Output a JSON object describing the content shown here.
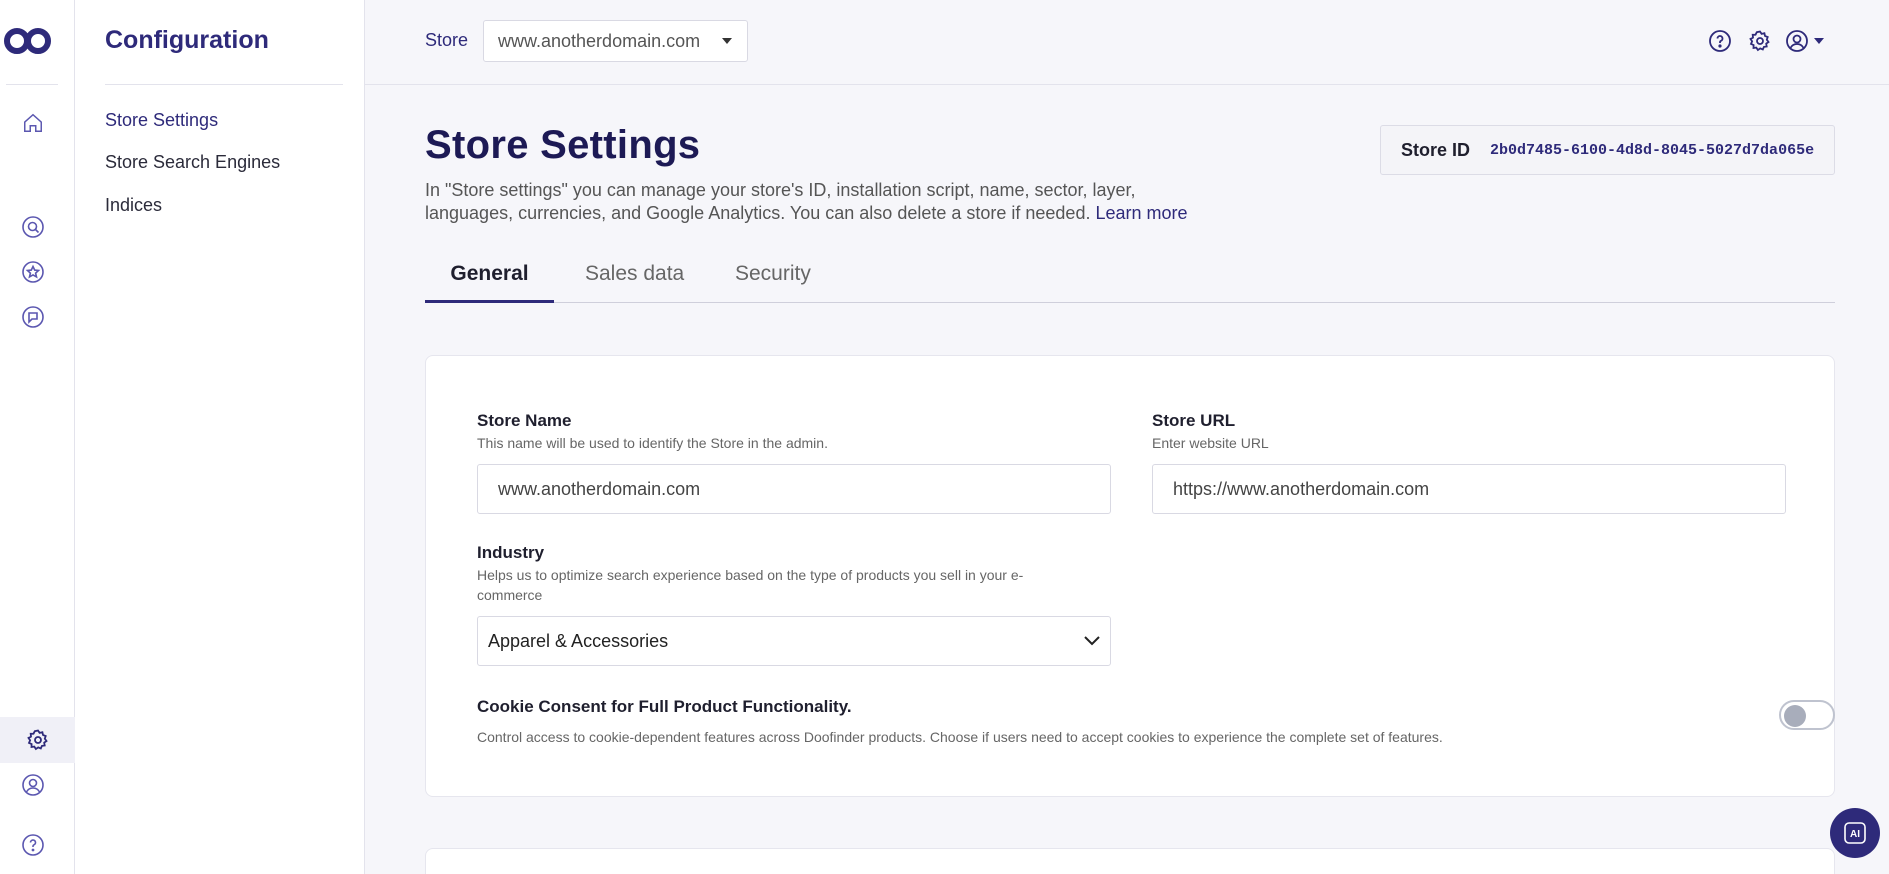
{
  "rail": {
    "icons": [
      "doofinder-logo",
      "home-icon",
      "search-icon",
      "star-icon",
      "chat-icon",
      "gear-icon",
      "user-icon",
      "help-icon"
    ]
  },
  "sidebar": {
    "title": "Configuration",
    "items": [
      {
        "label": "Store Settings",
        "active": true
      },
      {
        "label": "Store Search Engines",
        "active": false
      },
      {
        "label": "Indices",
        "active": false
      }
    ]
  },
  "topbar": {
    "store_label": "Store",
    "store_value": "www.anotherdomain.com"
  },
  "page": {
    "title": "Store Settings",
    "description": "In \"Store settings\" you can manage your store's ID, installation script, name, sector, layer, languages, currencies, and Google Analytics. You can also delete a store if needed.",
    "learn_more": "Learn more",
    "store_id_label": "Store ID",
    "store_id_value": "2b0d7485-6100-4d8d-8045-5027d7da065e"
  },
  "tabs": [
    {
      "label": "General",
      "active": true
    },
    {
      "label": "Sales data",
      "active": false
    },
    {
      "label": "Security",
      "active": false
    }
  ],
  "form": {
    "store_name": {
      "label": "Store Name",
      "help": "This name will be used to identify the Store in the admin.",
      "value": "www.anotherdomain.com"
    },
    "store_url": {
      "label": "Store URL",
      "help": "Enter website URL",
      "value": "https://www.anotherdomain.com"
    },
    "industry": {
      "label": "Industry",
      "help": "Helps us to optimize search experience based on the type of products you sell in your e-commerce",
      "value": "Apparel & Accessories"
    },
    "cookie": {
      "label": "Cookie Consent for Full Product Functionality.",
      "help": "Control access to cookie-dependent features across Doofinder products. Choose if users need to accept cookies to experience the complete set of features.",
      "enabled": false
    }
  },
  "ai_button_label": "AI",
  "colors": {
    "accent": "#2e2a7a",
    "background": "#f6f6fa"
  }
}
